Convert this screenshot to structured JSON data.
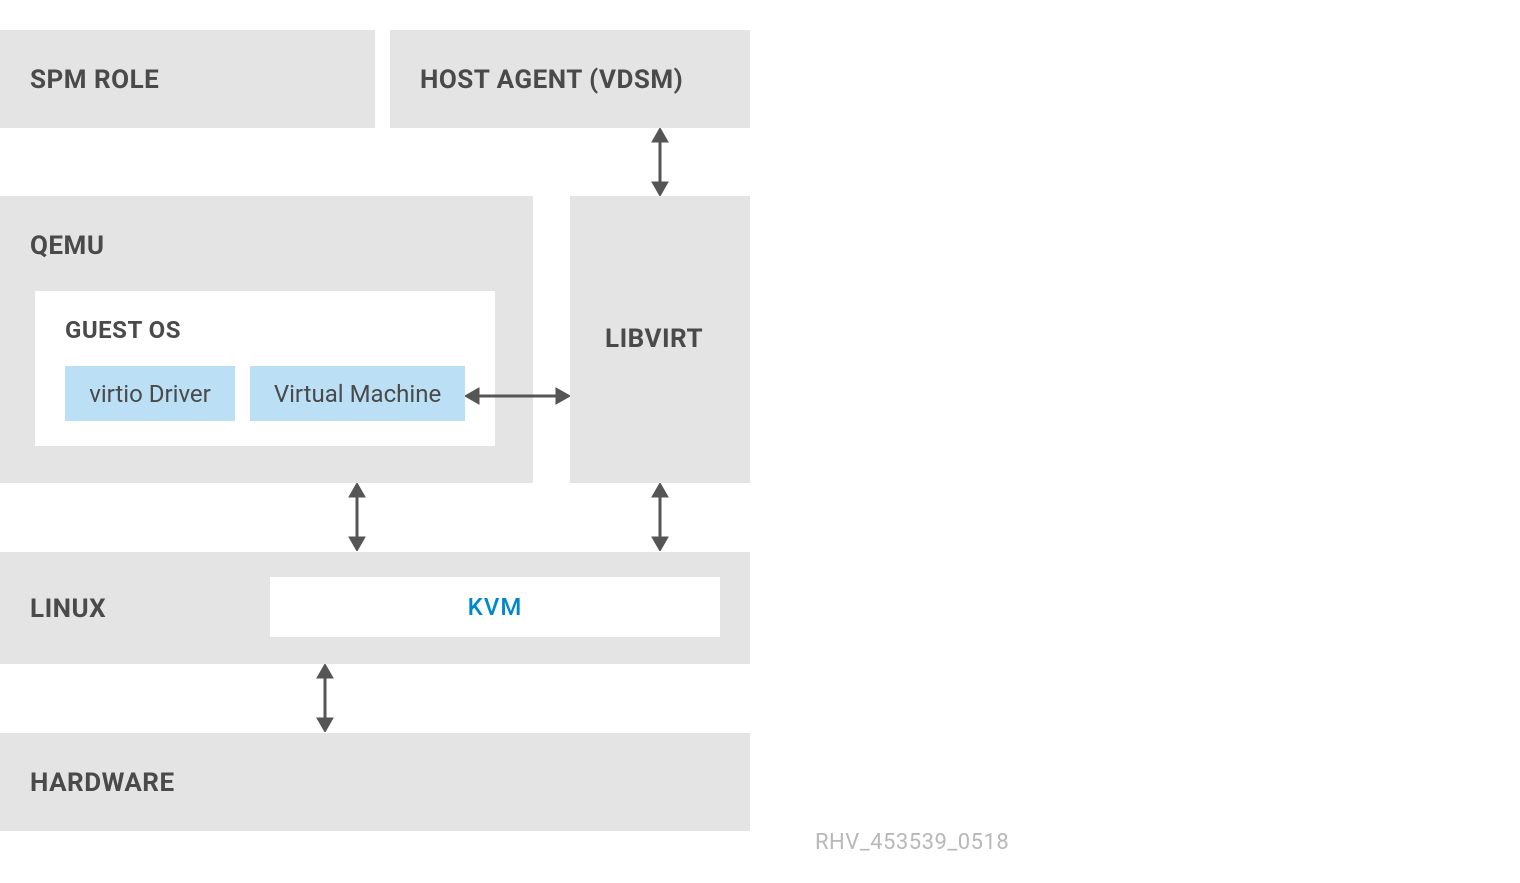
{
  "blocks": {
    "spm_role": "SPM ROLE",
    "host_agent": "HOST AGENT (VDSM)",
    "qemu": "QEMU",
    "guest_os": "GUEST OS",
    "virtio_driver": "virtio Driver",
    "virtual_machine": "Virtual Machine",
    "libvirt": "LIBVIRT",
    "linux": "LINUX",
    "kvm": "KVM",
    "hardware": "HARDWARE"
  },
  "footer": "RHV_453539_0518"
}
